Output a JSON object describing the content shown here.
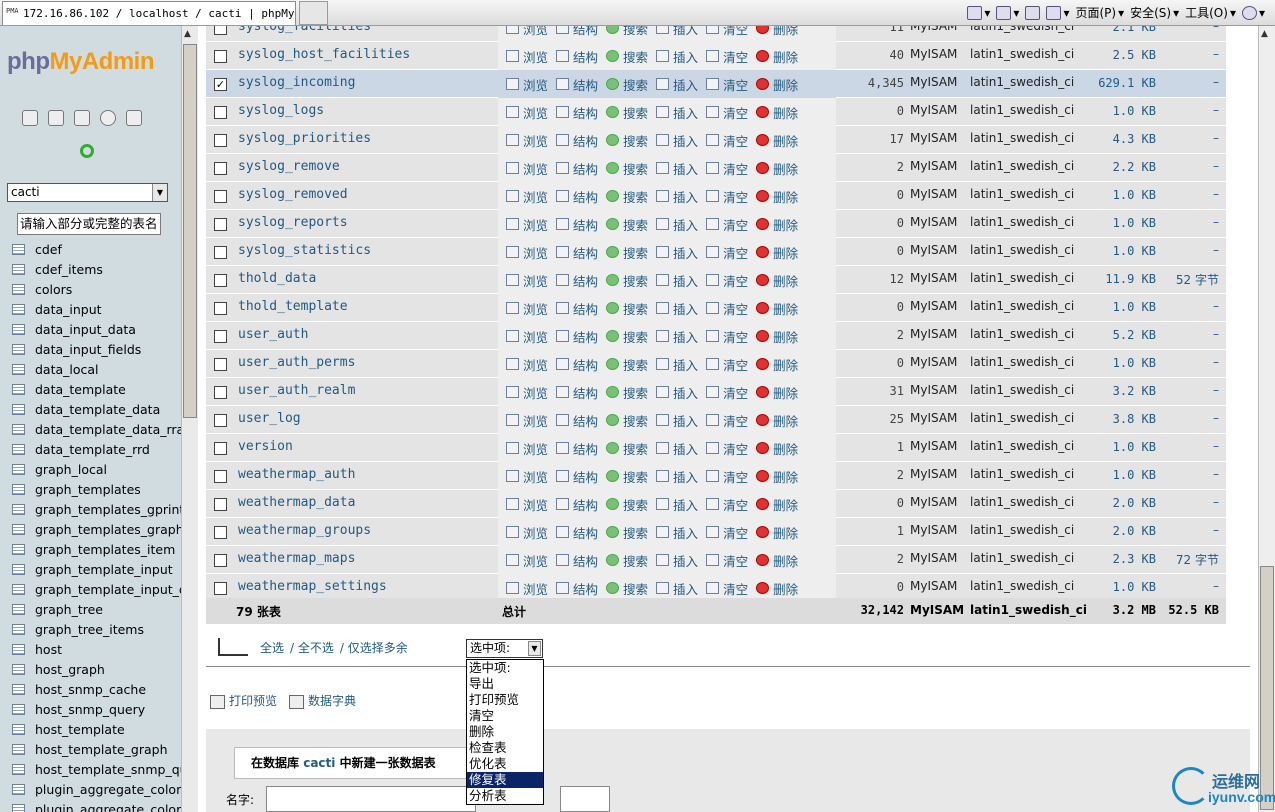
{
  "browser": {
    "tab_title": "172.16.86.102 / localhost / cacti | phpMy...",
    "toolbar": {
      "page_label": "页面(P)",
      "safety_label": "安全(S)",
      "tools_label": "工具(O)"
    }
  },
  "sidebar": {
    "logo_php": "php",
    "logo_myadmin": "MyAdmin",
    "db_select": "cacti",
    "filter_placeholder": "请输入部分或完整的表名",
    "tables": [
      "cdef",
      "cdef_items",
      "colors",
      "data_input",
      "data_input_data",
      "data_input_fields",
      "data_local",
      "data_template",
      "data_template_data",
      "data_template_data_rra",
      "data_template_rrd",
      "graph_local",
      "graph_templates",
      "graph_templates_gprint",
      "graph_templates_graph",
      "graph_templates_item",
      "graph_template_input",
      "graph_template_input_de",
      "graph_tree",
      "graph_tree_items",
      "host",
      "host_graph",
      "host_snmp_cache",
      "host_snmp_query",
      "host_template",
      "host_template_graph",
      "host_template_snmp_que",
      "plugin_aggregate_color_t",
      "plugin_aggregate_color_t"
    ]
  },
  "actions": {
    "browse": "浏览",
    "structure": "结构",
    "search": "搜索",
    "insert": "插入",
    "empty": "清空",
    "drop": "删除"
  },
  "rows": [
    {
      "name": "syslog_facilities",
      "rows": "11",
      "engine": "MyISAM",
      "collation": "latin1_swedish_ci",
      "size": "2.1 KB",
      "overhead": "–",
      "checked": false
    },
    {
      "name": "syslog_host_facilities",
      "rows": "40",
      "engine": "MyISAM",
      "collation": "latin1_swedish_ci",
      "size": "2.5 KB",
      "overhead": "–",
      "checked": false
    },
    {
      "name": "syslog_incoming",
      "rows": "4,345",
      "engine": "MyISAM",
      "collation": "latin1_swedish_ci",
      "size": "629.1 KB",
      "overhead": "–",
      "checked": true
    },
    {
      "name": "syslog_logs",
      "rows": "0",
      "engine": "MyISAM",
      "collation": "latin1_swedish_ci",
      "size": "1.0 KB",
      "overhead": "–",
      "checked": false
    },
    {
      "name": "syslog_priorities",
      "rows": "17",
      "engine": "MyISAM",
      "collation": "latin1_swedish_ci",
      "size": "4.3 KB",
      "overhead": "–",
      "checked": false
    },
    {
      "name": "syslog_remove",
      "rows": "2",
      "engine": "MyISAM",
      "collation": "latin1_swedish_ci",
      "size": "2.2 KB",
      "overhead": "–",
      "checked": false
    },
    {
      "name": "syslog_removed",
      "rows": "0",
      "engine": "MyISAM",
      "collation": "latin1_swedish_ci",
      "size": "1.0 KB",
      "overhead": "–",
      "checked": false
    },
    {
      "name": "syslog_reports",
      "rows": "0",
      "engine": "MyISAM",
      "collation": "latin1_swedish_ci",
      "size": "1.0 KB",
      "overhead": "–",
      "checked": false
    },
    {
      "name": "syslog_statistics",
      "rows": "0",
      "engine": "MyISAM",
      "collation": "latin1_swedish_ci",
      "size": "1.0 KB",
      "overhead": "–",
      "checked": false
    },
    {
      "name": "thold_data",
      "rows": "12",
      "engine": "MyISAM",
      "collation": "latin1_swedish_ci",
      "size": "11.9 KB",
      "overhead": "52 字节",
      "checked": false
    },
    {
      "name": "thold_template",
      "rows": "0",
      "engine": "MyISAM",
      "collation": "latin1_swedish_ci",
      "size": "1.0 KB",
      "overhead": "–",
      "checked": false
    },
    {
      "name": "user_auth",
      "rows": "2",
      "engine": "MyISAM",
      "collation": "latin1_swedish_ci",
      "size": "5.2 KB",
      "overhead": "–",
      "checked": false
    },
    {
      "name": "user_auth_perms",
      "rows": "0",
      "engine": "MyISAM",
      "collation": "latin1_swedish_ci",
      "size": "1.0 KB",
      "overhead": "–",
      "checked": false
    },
    {
      "name": "user_auth_realm",
      "rows": "31",
      "engine": "MyISAM",
      "collation": "latin1_swedish_ci",
      "size": "3.2 KB",
      "overhead": "–",
      "checked": false
    },
    {
      "name": "user_log",
      "rows": "25",
      "engine": "MyISAM",
      "collation": "latin1_swedish_ci",
      "size": "3.8 KB",
      "overhead": "–",
      "checked": false
    },
    {
      "name": "version",
      "rows": "1",
      "engine": "MyISAM",
      "collation": "latin1_swedish_ci",
      "size": "1.0 KB",
      "overhead": "–",
      "checked": false
    },
    {
      "name": "weathermap_auth",
      "rows": "2",
      "engine": "MyISAM",
      "collation": "latin1_swedish_ci",
      "size": "1.0 KB",
      "overhead": "–",
      "checked": false
    },
    {
      "name": "weathermap_data",
      "rows": "0",
      "engine": "MyISAM",
      "collation": "latin1_swedish_ci",
      "size": "2.0 KB",
      "overhead": "–",
      "checked": false
    },
    {
      "name": "weathermap_groups",
      "rows": "1",
      "engine": "MyISAM",
      "collation": "latin1_swedish_ci",
      "size": "2.0 KB",
      "overhead": "–",
      "checked": false
    },
    {
      "name": "weathermap_maps",
      "rows": "2",
      "engine": "MyISAM",
      "collation": "latin1_swedish_ci",
      "size": "2.3 KB",
      "overhead": "72 字节",
      "checked": false
    },
    {
      "name": "weathermap_settings",
      "rows": "0",
      "engine": "MyISAM",
      "collation": "latin1_swedish_ci",
      "size": "1.0 KB",
      "overhead": "–",
      "checked": false
    }
  ],
  "summary": {
    "tables": "79 张表",
    "total": "总计",
    "rows": "32,142",
    "engine": "MyISAM",
    "collation": "latin1_swedish_ci",
    "size": "3.2 MB",
    "overhead": "52.5 KB"
  },
  "selection": {
    "check_all": "全选",
    "uncheck_all": "/ 全不选",
    "check_overhead": "/ 仅选择多余",
    "select_value": "选中项:"
  },
  "dropdown_options": [
    "选中项:",
    "导出",
    "打印预览",
    "清空",
    "删除",
    "检查表",
    "优化表",
    "修复表",
    "分析表"
  ],
  "dropdown_selected_index": 7,
  "links": {
    "print_view": "打印预览",
    "data_dict": "数据字典"
  },
  "create": {
    "prefix": "在数据库",
    "db": "cacti",
    "suffix": "中新建一张数据表",
    "name_label": "名字:"
  },
  "watermark": {
    "cn": "运维网",
    "url": "iyunv.com"
  }
}
